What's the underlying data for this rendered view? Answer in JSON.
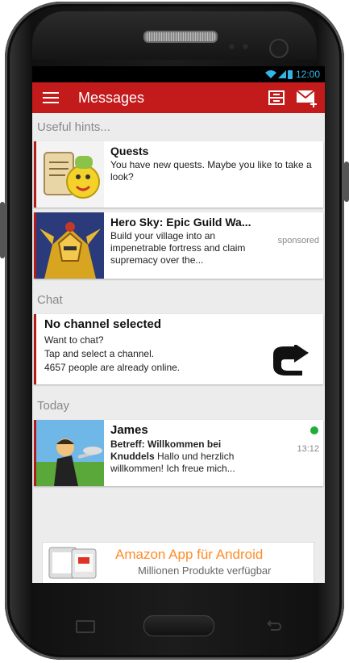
{
  "status_bar": {
    "time": "12:00"
  },
  "action_bar": {
    "title": "Messages"
  },
  "sections": {
    "hints": "Useful hints...",
    "chat": "Chat",
    "today": "Today"
  },
  "cards": {
    "quests": {
      "title": "Quests",
      "text": "You have new quests. Maybe you like to take a look?"
    },
    "hero": {
      "title": "Hero Sky: Epic Guild Wa...",
      "text": "Build your village into an impenetrable fortress and claim supremacy over the...",
      "badge": "sponsored"
    },
    "chat": {
      "title": "No channel selected",
      "line1": "Want to chat?",
      "line2": "Tap and select a channel.",
      "line3": "4657 people are already online."
    },
    "james": {
      "title": "James",
      "subject": "Betreff: Willkommen bei Knuddels",
      "text": "Hallo und herzlich willkommen!  Ich freue mich...",
      "time": "13:12"
    }
  },
  "ad": {
    "line1": "Amazon App für Android",
    "line2": "Millionen Produkte verfügbar"
  },
  "colors": {
    "accent": "#c31b1b",
    "status_blue": "#33b5e5",
    "online": "#1fae3b",
    "ad_orange": "#ff8c28"
  }
}
